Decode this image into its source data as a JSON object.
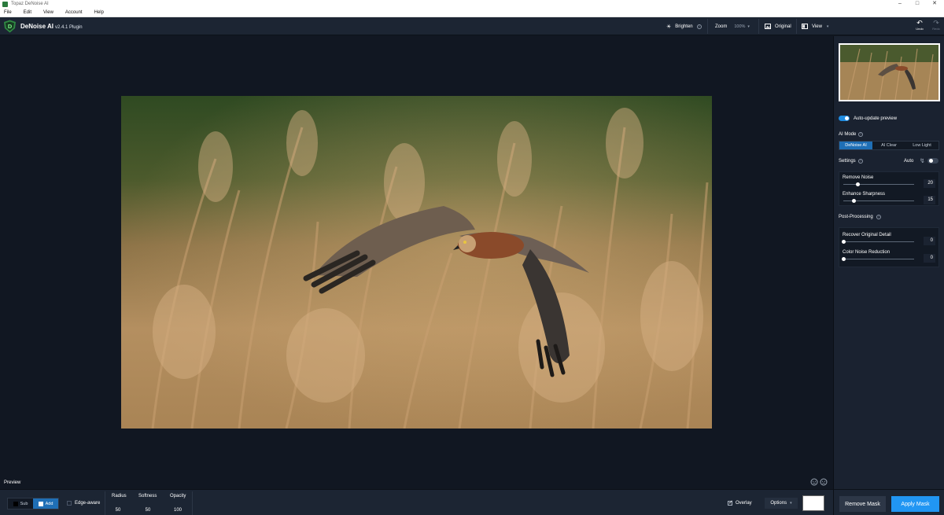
{
  "window": {
    "title": "Topaz DeNoise AI"
  },
  "menu": [
    "File",
    "Edit",
    "View",
    "Account",
    "Help"
  ],
  "header": {
    "app_name": "DeNoise AI",
    "version": "v2.4.1 Plugin",
    "brighten_label": "Brighten",
    "zoom_label": "Zoom",
    "zoom_value": "100%",
    "original_label": "Original",
    "view_label": "View",
    "undo_label": "Undo",
    "redo_label": "Redo"
  },
  "canvas": {
    "preview_label": "Preview"
  },
  "panel": {
    "auto_update_label": "Auto-update preview",
    "auto_update_on": true,
    "ai_mode_label": "AI Mode",
    "modes": [
      "DeNoise AI",
      "AI Clear",
      "Low Light"
    ],
    "active_mode": "DeNoise AI",
    "settings_label": "Settings",
    "auto_label": "Auto",
    "auto_on": false,
    "sliders": [
      {
        "label": "Remove Noise",
        "value": "20",
        "fraction": 0.2
      },
      {
        "label": "Enhance Sharpness",
        "value": "15",
        "fraction": 0.15
      }
    ],
    "post_processing_label": "Post-Processing",
    "post_sliders": [
      {
        "label": "Recover Original Detail",
        "value": "0",
        "fraction": 0
      },
      {
        "label": "Color Noise Reduction",
        "value": "0",
        "fraction": 0
      }
    ]
  },
  "bottom": {
    "sub_label": "Sub",
    "add_label": "Add",
    "active": "Add",
    "edge_aware_label": "Edge-aware",
    "edge_aware_checked": false,
    "radius_label": "Radius",
    "radius_value": "50",
    "softness_label": "Softness",
    "softness_value": "50",
    "opacity_label": "Opacity",
    "opacity_value": "100",
    "overlay_label": "Overlay",
    "overlay_checked": true,
    "options_label": "Options",
    "remove_mask_label": "Remove Mask",
    "apply_mask_label": "Apply Mask"
  },
  "colors": {
    "accent": "#2196f3",
    "active_mode": "#1f6fb6",
    "bg_dark": "#111722",
    "panel": "#1a2230"
  }
}
